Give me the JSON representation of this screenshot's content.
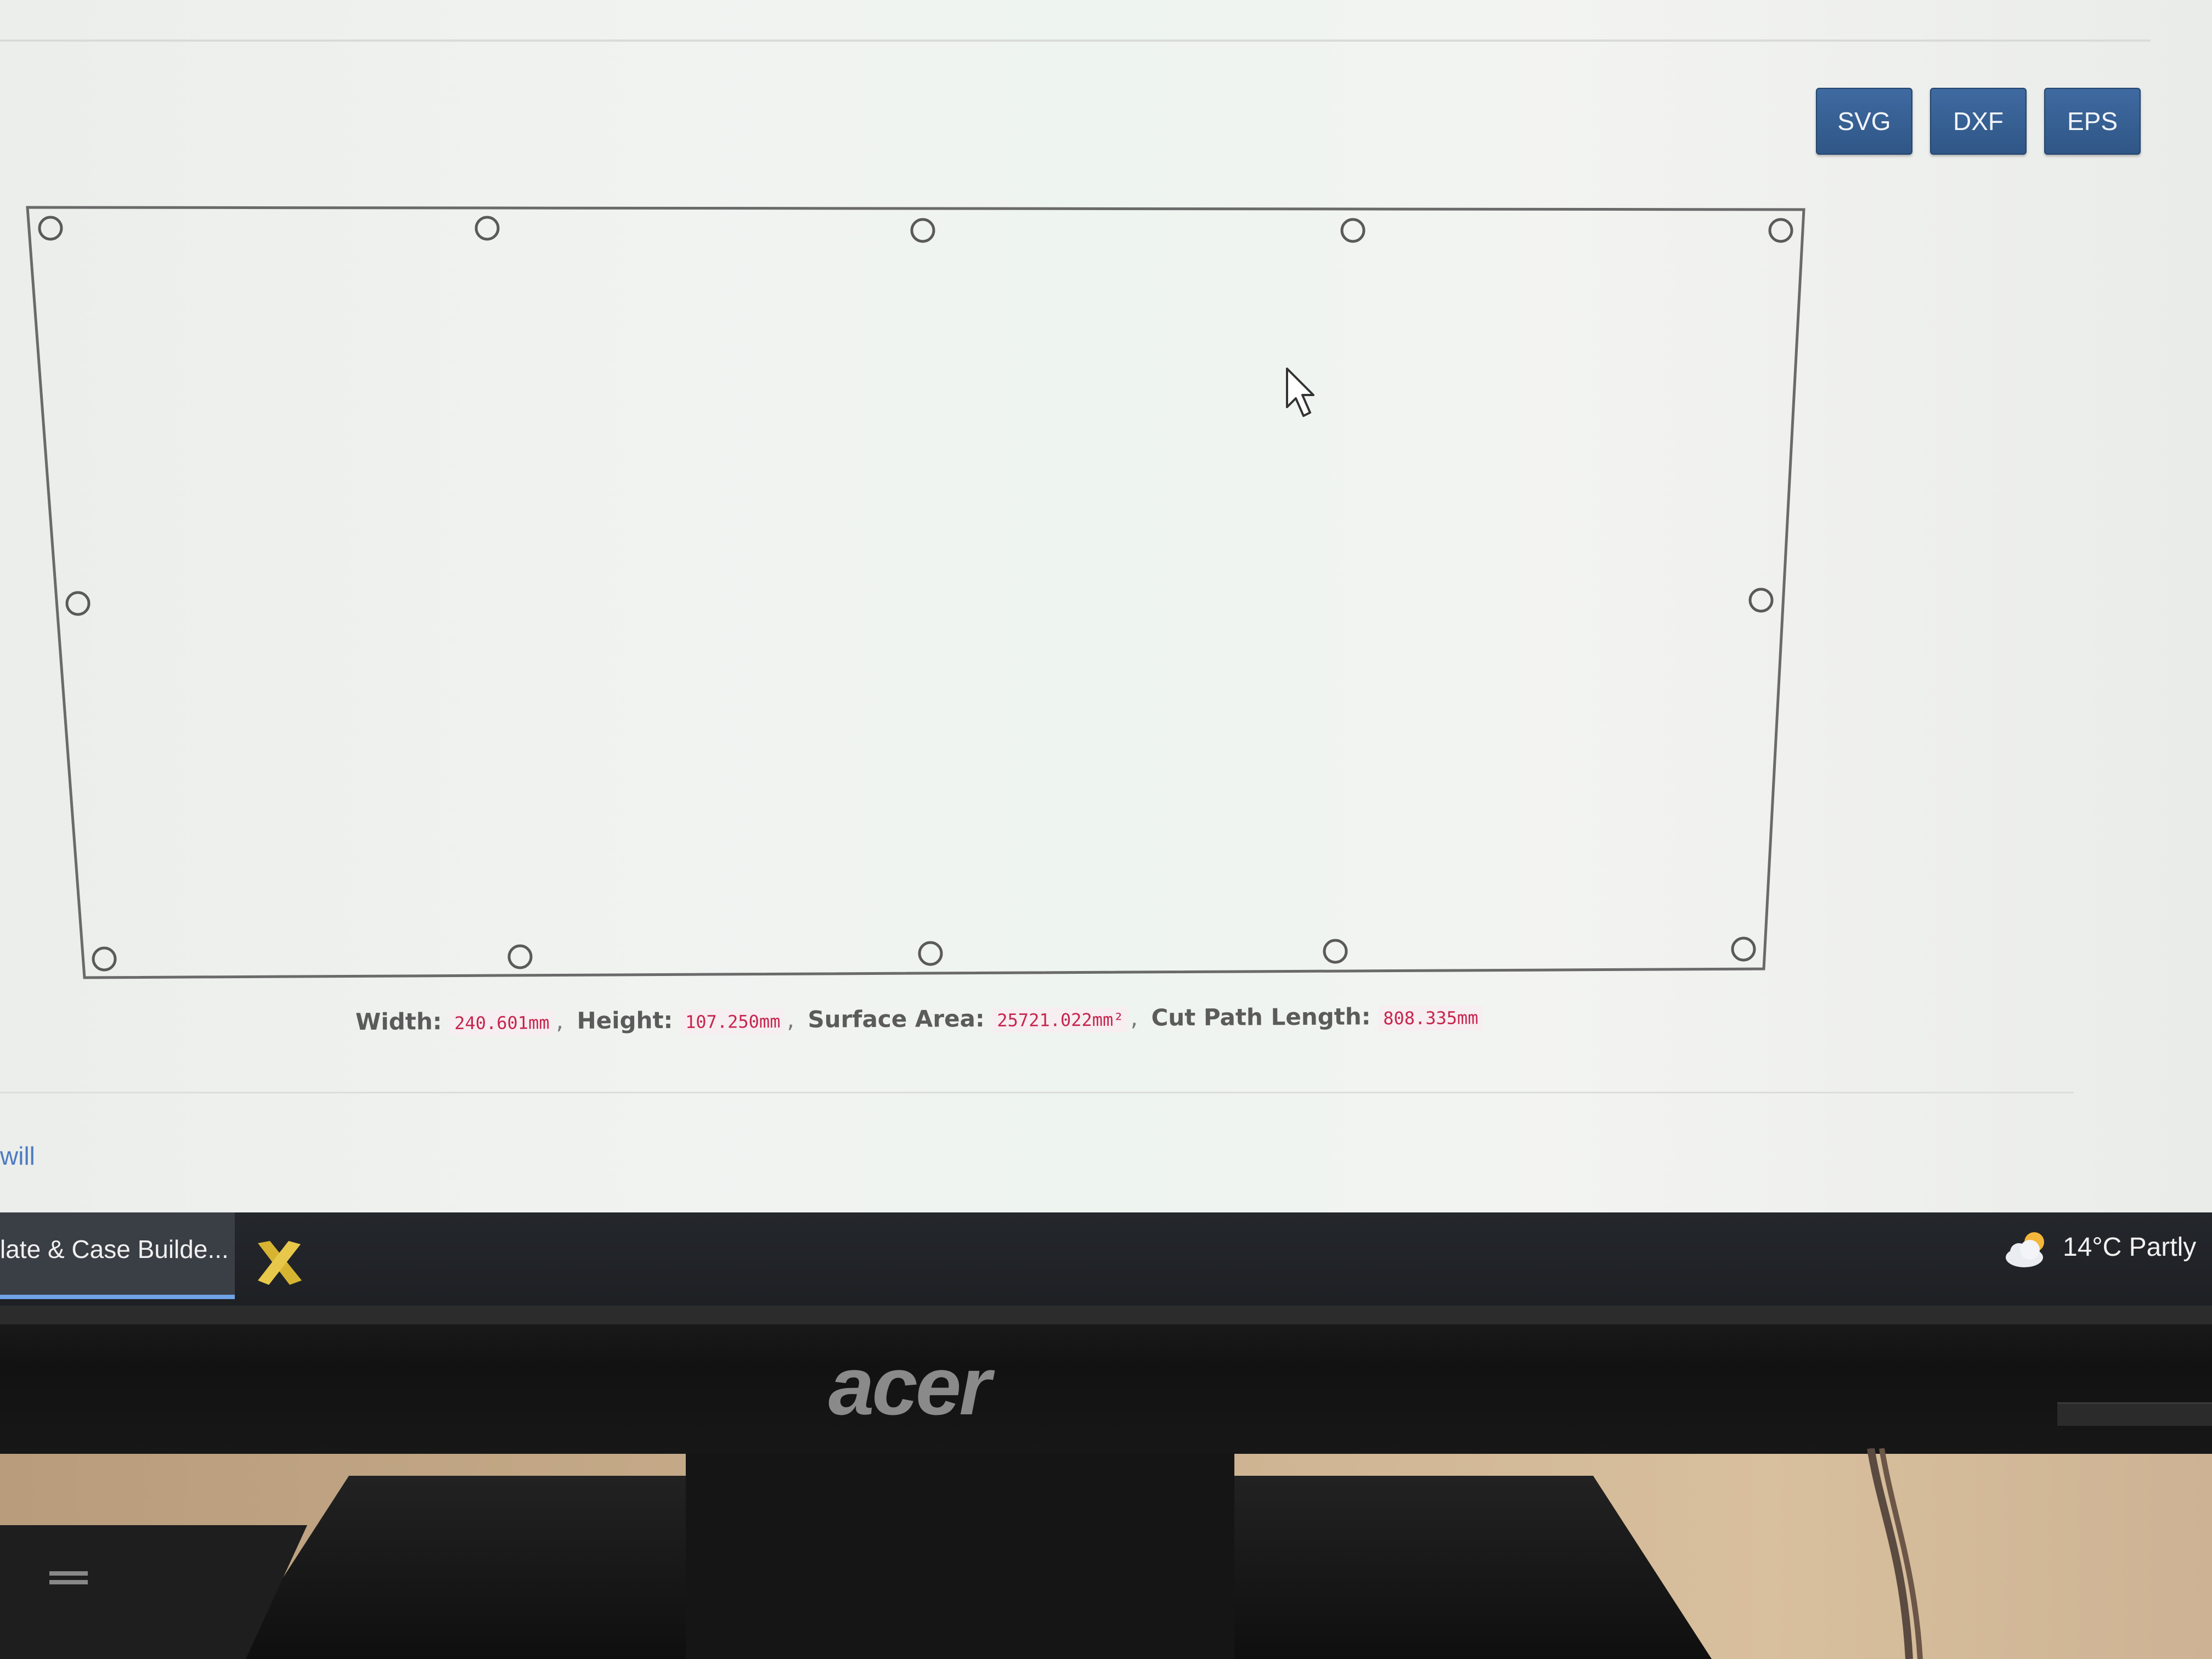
{
  "toolbar": {
    "svg_label": "SVG",
    "dxf_label": "DXF",
    "eps_label": "EPS"
  },
  "info": {
    "width_label": "Width:",
    "width_value": "240.601mm",
    "height_label": "Height:",
    "height_value": "107.250mm",
    "area_label": "Surface Area:",
    "area_value": "25721.022mm²",
    "cut_label": "Cut Path Length:",
    "cut_value": "808.335mm",
    "separator": ","
  },
  "footer_link": "will",
  "taskbar": {
    "app_label": "late & Case Builde...",
    "weather_temp": "14°C",
    "weather_desc": "Partly"
  },
  "brand": "acer",
  "colors": {
    "button_bg": "#3a6399",
    "code_text": "#c7254e",
    "link": "#4d7bc0",
    "taskbar_accent": "#6fa3e6"
  },
  "icons": [
    "cursor-arrow-icon",
    "x-app-icon",
    "partly-cloudy-icon"
  ]
}
